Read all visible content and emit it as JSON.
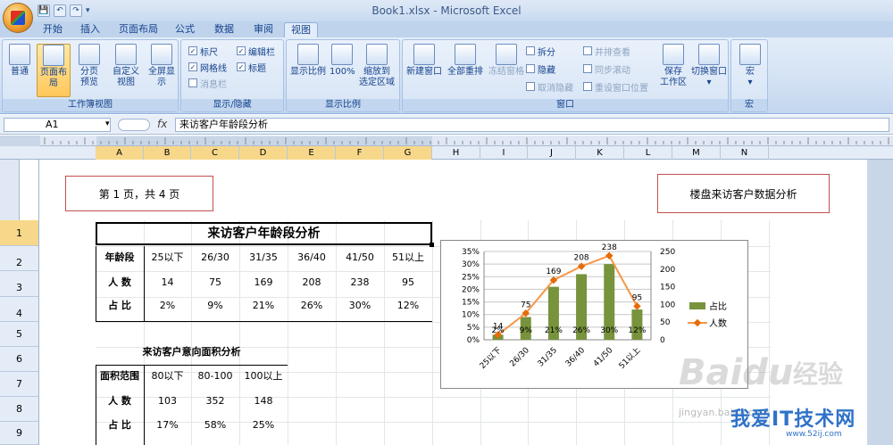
{
  "window": {
    "title": "Book1.xlsx - Microsoft Excel"
  },
  "quick_access": {
    "save": "💾",
    "undo": "↶",
    "redo": "↷"
  },
  "tabs": [
    "开始",
    "插入",
    "页面布局",
    "公式",
    "数据",
    "审阅",
    "视图"
  ],
  "active_tab": "视图",
  "ribbon": {
    "workbook_views": {
      "label": "工作簿视图",
      "buttons": [
        "普通",
        "页面布局",
        "分页\n预览",
        "自定义\n视图",
        "全屏显示"
      ]
    },
    "show_hide": {
      "label": "显示/隐藏",
      "ruler": "标尺",
      "gridlines": "网格线",
      "message_bar": "消息栏",
      "formula_bar": "编辑栏",
      "headings": "标题"
    },
    "zoom": {
      "label": "显示比例",
      "buttons": [
        "显示比例",
        "100%",
        "缩放到\n选定区域"
      ]
    },
    "window": {
      "label": "窗口",
      "new_window": "新建窗口",
      "arrange_all": "全部重排",
      "freeze_panes": "冻结窗格",
      "split": "拆分",
      "hide": "隐藏",
      "unhide": "取消隐藏",
      "side_by_side": "并排查看",
      "sync_scroll": "同步滚动",
      "reset_position": "重设窗口位置",
      "save_workspace": "保存\n工作区",
      "switch_windows": "切换窗口"
    },
    "macros": {
      "label": "宏",
      "button": "宏"
    }
  },
  "formula_bar": {
    "name_box": "A1",
    "fx": "fx",
    "content": "来访客户年龄段分析"
  },
  "columns": [
    "A",
    "B",
    "C",
    "D",
    "E",
    "F",
    "G",
    "H",
    "I",
    "J",
    "K",
    "L",
    "M",
    "N"
  ],
  "rows": [
    "1",
    "2",
    "3",
    "4",
    "5",
    "6",
    "7",
    "8",
    "9"
  ],
  "header_left": "第 1 页，共 4 页",
  "header_right": "楼盘来访客户数据分析",
  "sheet": {
    "title": "来访客户年龄段分析",
    "age_row": [
      "年龄段",
      "25以下",
      "26/30",
      "31/35",
      "36/40",
      "41/50",
      "51以上"
    ],
    "count_row": [
      "人  数",
      "14",
      "75",
      "169",
      "208",
      "238",
      "95"
    ],
    "ratio_row": [
      "占  比",
      "2%",
      "9%",
      "21%",
      "26%",
      "30%",
      "12%"
    ],
    "area_title": "来访客户意向面积分析",
    "area_row": [
      "面积范围",
      "80以下",
      "80-100",
      "100以上"
    ],
    "area_count": [
      "人  数",
      "103",
      "352",
      "148"
    ],
    "area_ratio": [
      "占  比",
      "17%",
      "58%",
      "25%"
    ]
  },
  "chart_data": {
    "type": "bar",
    "categories": [
      "25以下",
      "26/30",
      "31/35",
      "36/40",
      "41/50",
      "51以上"
    ],
    "series": [
      {
        "name": "占比",
        "type": "bar",
        "axis": "left",
        "values": [
          2,
          9,
          21,
          26,
          30,
          12
        ],
        "labels": [
          "2%",
          "9%",
          "21%",
          "26%",
          "30%",
          "12%"
        ],
        "color": "#77933c"
      },
      {
        "name": "人数",
        "type": "line",
        "axis": "right",
        "values": [
          14,
          75,
          169,
          208,
          238,
          95
        ],
        "color": "#f79646"
      }
    ],
    "left_axis": {
      "ticks": [
        "0%",
        "5%",
        "10%",
        "15%",
        "20%",
        "25%",
        "30%",
        "35%"
      ],
      "ylim": [
        0,
        35
      ]
    },
    "right_axis": {
      "ticks": [
        "0",
        "50",
        "100",
        "150",
        "200",
        "250"
      ],
      "ylim": [
        0,
        250
      ]
    },
    "legend": "right",
    "grid": true
  },
  "watermark": {
    "text1": "Bai",
    "text2": "du",
    "text3": "经验",
    "site": "我爱IT技术网",
    "url": "jingyan.baidu.com",
    "url2": "www.52ij.com"
  }
}
